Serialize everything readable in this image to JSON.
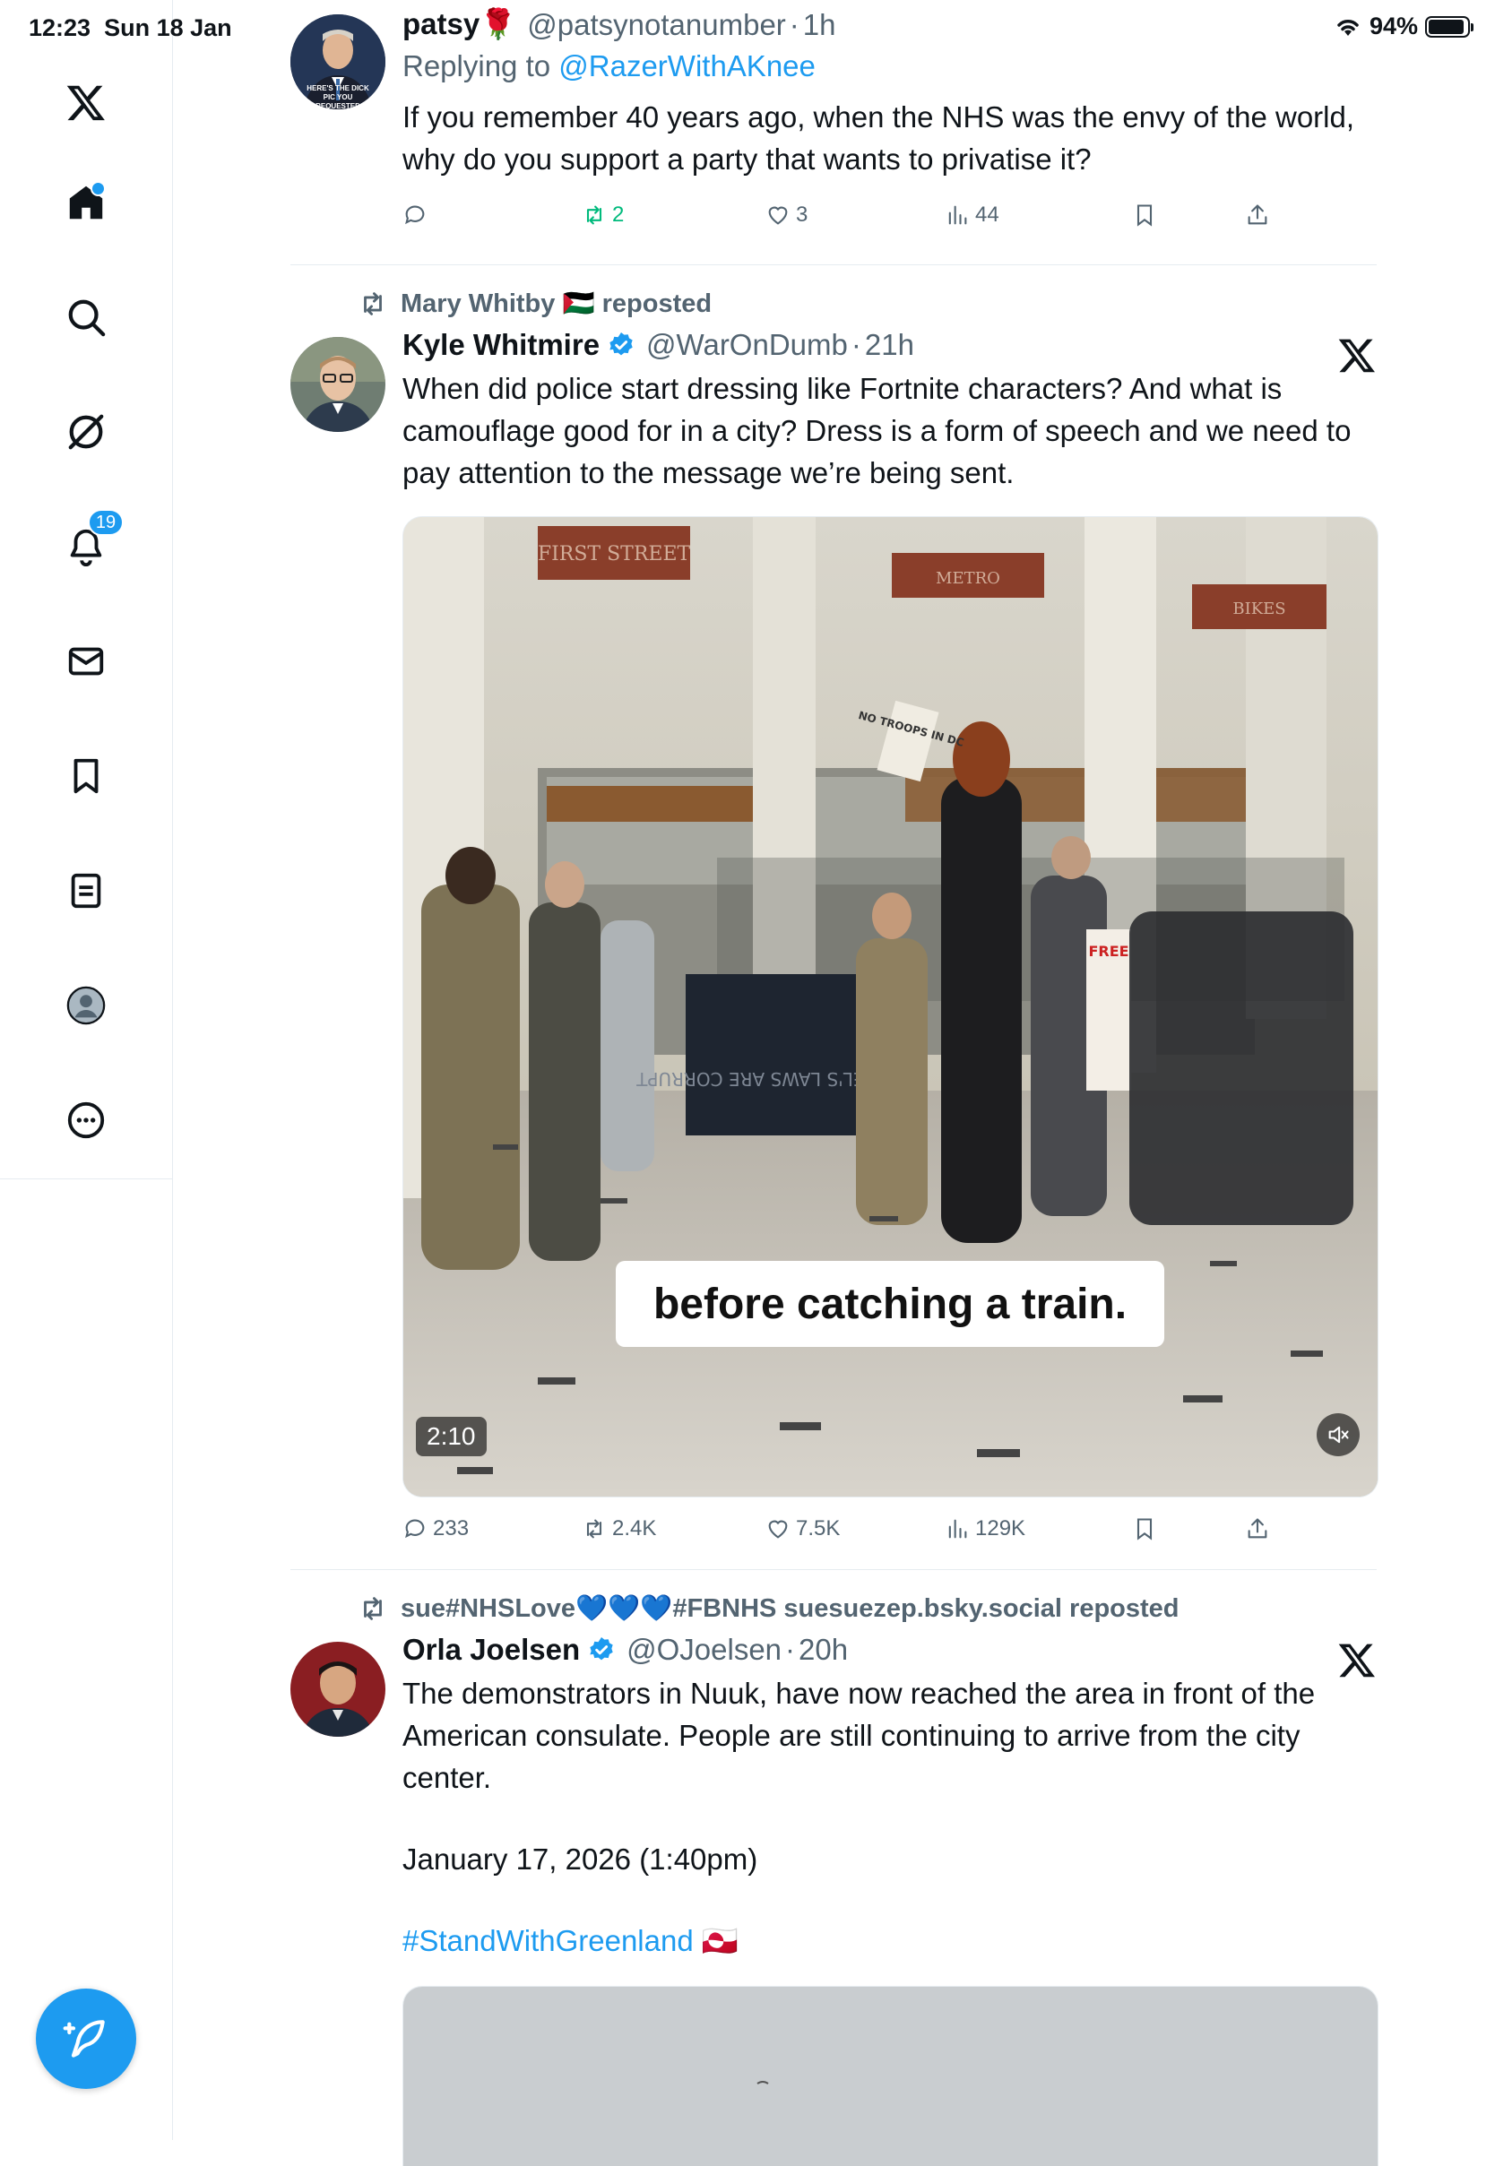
{
  "status_bar": {
    "time": "12:23",
    "date": "Sun 18 Jan",
    "battery": "94%"
  },
  "sidebar": {
    "notifications_count": "19",
    "items": [
      "x-logo",
      "home",
      "search",
      "grok",
      "notifications",
      "messages",
      "bookmarks",
      "lists",
      "profile",
      "more"
    ]
  },
  "tweets": [
    {
      "name": "patsy🌹",
      "handle": "@patsynotanumber",
      "time": "1h",
      "replying_prefix": "Replying to ",
      "replying_to": "@RazerWithAKnee",
      "avatar_caption": "HERE'S THE DICK PIC YOU REQUESTED",
      "text": "If you remember 40 years ago, when the NHS was the envy of the world, why do you support a party that wants to privatise it?",
      "replies": "",
      "reposts": "2",
      "likes": "3",
      "views": "44"
    },
    {
      "reposted_by": "Mary Whitby 🇵🇸 reposted",
      "name": "Kyle Whitmire",
      "handle": "@WarOnDumb",
      "time": "21h",
      "verified": true,
      "text": "When did police start dressing like Fortnite characters? And what is camouflage good for in a city? Dress is a form of speech and we need to pay attention to the message we’re being sent.",
      "video": {
        "caption": "before catching a train.",
        "duration": "2:10",
        "signs": [
          "FIRST STREET",
          "METRO",
          "BIKES"
        ],
        "protest_sign": "NO TROOPS IN DC",
        "banner_text": "ISRAEL'S LAWS ARE CORRUPT"
      },
      "replies": "233",
      "reposts": "2.4K",
      "likes": "7.5K",
      "views": "129K"
    },
    {
      "reposted_by": "sue#NHSLove💙💙💙#FBNHS suesuezep.bsky.social reposted",
      "name": "Orla Joelsen",
      "handle": "@OJoelsen",
      "time": "20h",
      "verified": true,
      "text": "The demonstrators in Nuuk, have now reached the area in front of the American consulate. People are still continuing to arrive from the city center.",
      "date_line": "January 17, 2026 (1:40pm)",
      "hashtag": "#StandWithGreenland",
      "flag": "🇬🇱"
    }
  ],
  "colors": {
    "accent": "#1d9bf0",
    "repost_green": "#00ba7c",
    "secondary_text": "#536471",
    "border": "#e6ecf0"
  }
}
